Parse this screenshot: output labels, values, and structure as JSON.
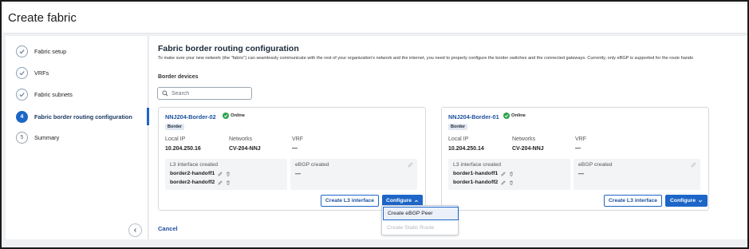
{
  "header": {
    "title": "Create fabric"
  },
  "sidebar": {
    "steps": [
      {
        "label": "Fabric setup",
        "number": "",
        "state": "done"
      },
      {
        "label": "VRFs",
        "number": "",
        "state": "done"
      },
      {
        "label": "Fabric subnets",
        "number": "",
        "state": "done"
      },
      {
        "label": "Fabric border routing configuration",
        "number": "4",
        "state": "active"
      },
      {
        "label": "Summary",
        "number": "5",
        "state": "pending"
      }
    ],
    "collapse_icon": "chevron-left-icon"
  },
  "main": {
    "title": "Fabric border routing configuration",
    "description": "To make sure your new network (the \"fabric\") can seamlessly communicate with the rest of your organization's network and the internet, you need to properly configure the border switches and the connected gateways. Currently, only eBGP is supported for the route hando",
    "section_label": "Border devices",
    "search": {
      "placeholder": "Search",
      "value": ""
    },
    "cancel_label": "Cancel"
  },
  "labels": {
    "local_ip": "Local IP",
    "networks": "Networks",
    "vrf": "VRF",
    "l3_interface_created": "L3 interface created",
    "ebgp_created": "eBGP created",
    "create_l3_interface": "Create L3 interface",
    "configure": "Configure"
  },
  "devices": [
    {
      "name": "NNJ204-Border-02",
      "status": "Online",
      "tag": "Border",
      "local_ip": "10.204.250.16",
      "networks": "CV-204-NNJ",
      "vrf": "—",
      "l3_interfaces": [
        "border2-handoff1",
        "border2-handoff2"
      ],
      "ebgp": "—",
      "configure_expanded": true
    },
    {
      "name": "NNJ204-Border-01",
      "status": "Online",
      "tag": "Border",
      "local_ip": "10.204.250.14",
      "networks": "CV-204-NNJ",
      "vrf": "—",
      "l3_interfaces": [
        "border1-handoff1",
        "border1-handoff2"
      ],
      "ebgp": "—",
      "configure_expanded": false
    }
  ],
  "configure_menu": {
    "items": [
      {
        "label": "Create eBGP Peer",
        "state": "selected"
      },
      {
        "label": "Create Static Route",
        "state": "disabled"
      }
    ]
  },
  "colors": {
    "accent": "#1d66c8",
    "online": "#2aa34a",
    "link": "#1a4f9c"
  }
}
